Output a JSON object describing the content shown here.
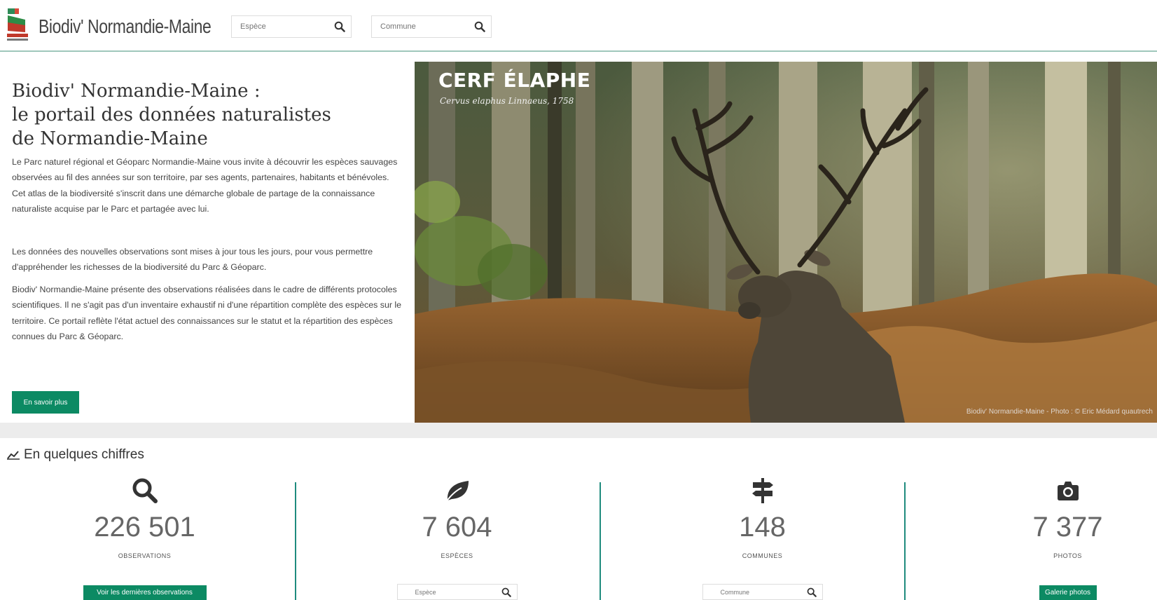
{
  "header": {
    "brand": "Biodiv' Normandie-Maine",
    "species_search_placeholder": "Espèce",
    "commune_search_placeholder": "Commune"
  },
  "intro": {
    "title_line1": "Biodiv' Normandie-Maine :",
    "title_line2": "le portail des données naturalistes",
    "title_line3": "de Normandie-Maine",
    "para1": "Le Parc naturel régional et Géoparc Normandie-Maine vous invite à découvrir les espèces sauvages observées au fil des années sur son territoire, par ses agents, partenaires, habitants et bénévoles. Cet atlas de la biodiversité s'inscrit dans une démarche globale de partage de la connaissance naturaliste acquise par le Parc et partagée avec lui.",
    "para2": "Les données des nouvelles observations sont mises à jour tous les jours, pour vous permettre d'appréhender les richesses de la biodiversité du Parc & Géoparc.",
    "para3": "Biodiv' Normandie-Maine présente des observations réalisées dans le cadre de différents protocoles scientifiques. Il ne s'agit pas d'un inventaire exhaustif ni d'une répartition complète des espèces sur le territoire. Ce portail reflète l'état actuel des connaissances sur le statut et la répartition des espèces connues du Parc & Géoparc.",
    "more_button": "En savoir plus"
  },
  "hero": {
    "species_name": "CERF ÉLAPHE",
    "scientific_name": "Cervus elaphus Linnaeus, 1758",
    "credit": "Biodiv' Normandie-Maine - Photo : © Eric Médard quautrech"
  },
  "stats": {
    "section_title": "En quelques chiffres",
    "items": [
      {
        "icon": "search-icon",
        "value": "226 501",
        "label": "OBSERVATIONS",
        "button": "Voir les dernières observations"
      },
      {
        "icon": "leaf-icon",
        "value": "7 604",
        "label": "ESPÈCES",
        "placeholder": "Espèce"
      },
      {
        "icon": "signpost-icon",
        "value": "148",
        "label": "COMMUNES",
        "placeholder": "Commune"
      },
      {
        "icon": "camera-icon",
        "value": "7 377",
        "label": "PHOTOS",
        "button": "Galerie photos"
      }
    ]
  },
  "colors": {
    "accent": "#0c8a63",
    "divider": "#1f8b7e",
    "band": "#ececec"
  }
}
